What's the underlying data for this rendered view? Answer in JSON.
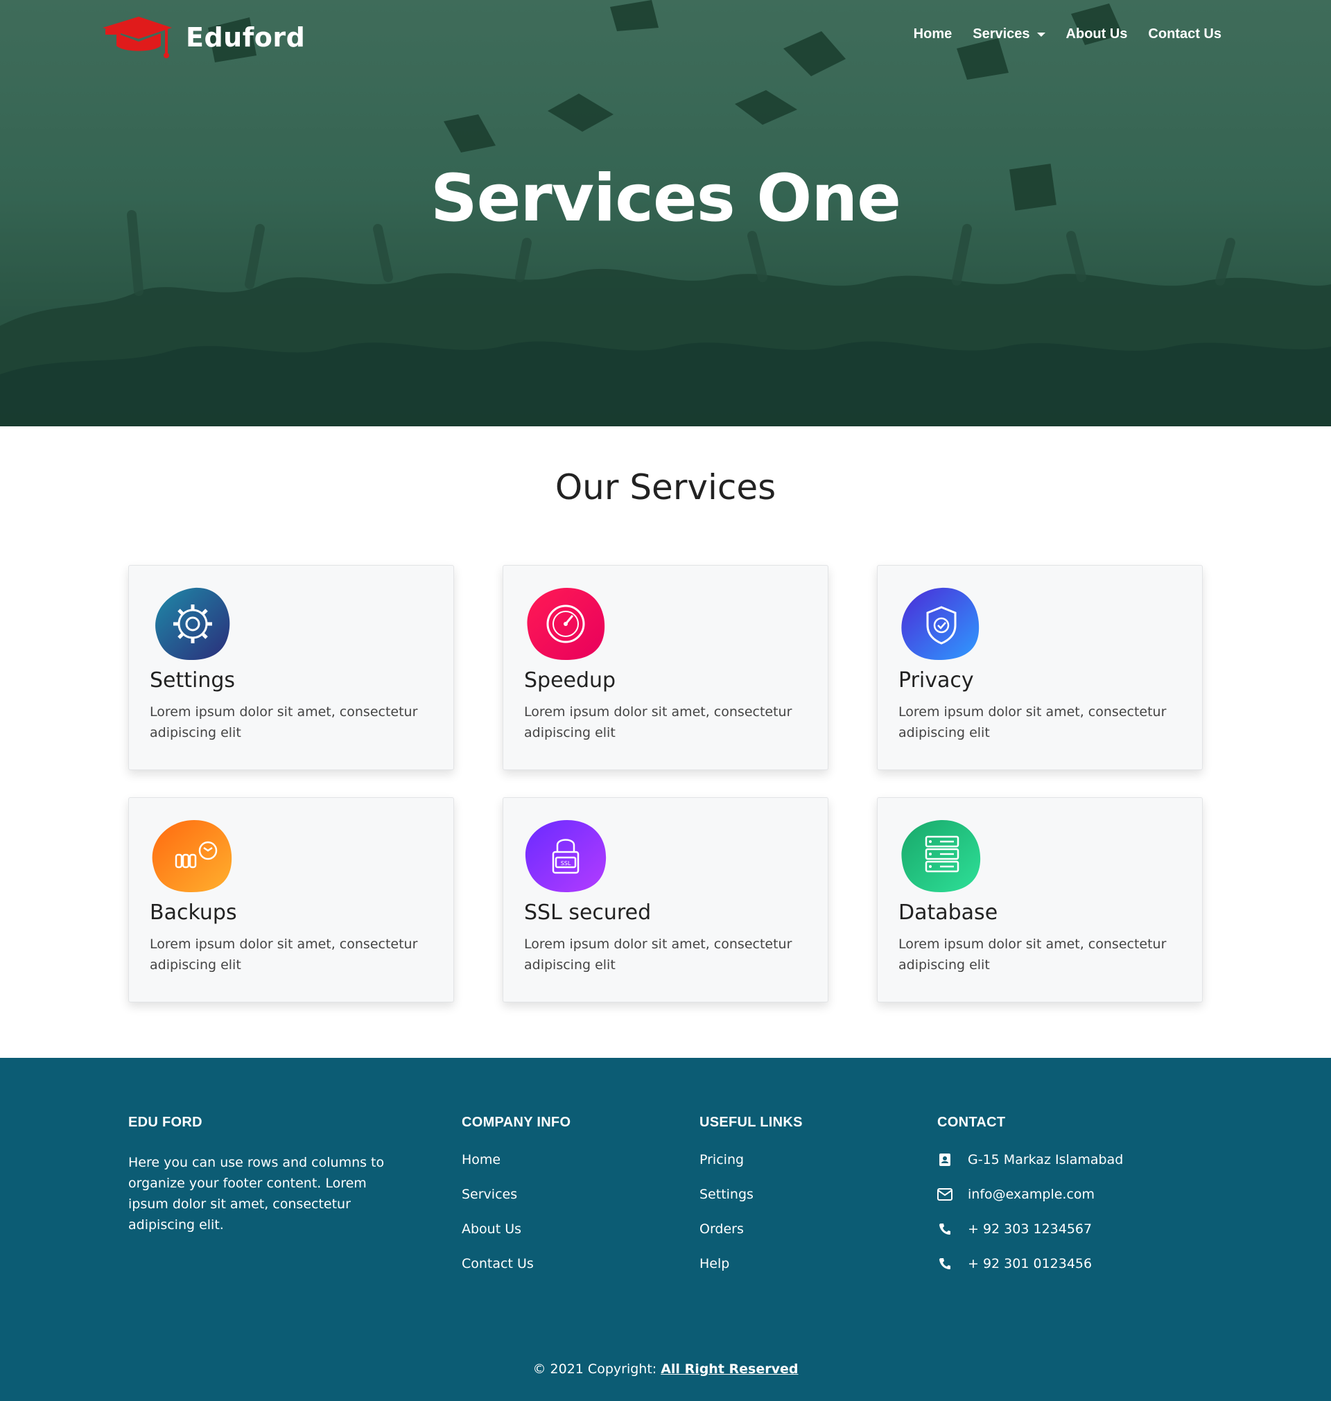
{
  "brand": {
    "name": "Eduford"
  },
  "nav": {
    "home": "Home",
    "services": "Services",
    "about": "About Us",
    "contact": "Contact Us"
  },
  "hero": {
    "title": "Services One"
  },
  "services": {
    "title": "Our Services",
    "items": [
      {
        "title": "Settings",
        "text": "Lorem ipsum dolor sit amet, consectetur adipiscing elit",
        "icon": "gear-icon",
        "colors": [
          "#1f8aa8",
          "#2b2d7a"
        ]
      },
      {
        "title": "Speedup",
        "text": "Lorem ipsum dolor sit amet, consectetur adipiscing elit",
        "icon": "speedometer-icon",
        "colors": [
          "#ff1a55",
          "#e8005c"
        ]
      },
      {
        "title": "Privacy",
        "text": "Lorem ipsum dolor sit amet, consectetur adipiscing elit",
        "icon": "shield-check-icon",
        "colors": [
          "#2f5bff",
          "#4b2bd6"
        ]
      },
      {
        "title": "Backups",
        "text": "Lorem ipsum dolor sit amet, consectetur adipiscing elit",
        "icon": "backup-icon",
        "colors": [
          "#ff7a1a",
          "#ffb02e"
        ]
      },
      {
        "title": "SSL secured",
        "text": "Lorem ipsum dolor sit amet, consectetur adipiscing elit",
        "icon": "ssl-lock-icon",
        "colors": [
          "#9b3cff",
          "#6a2bff"
        ]
      },
      {
        "title": "Database",
        "text": "Lorem ipsum dolor sit amet, consectetur adipiscing elit",
        "icon": "database-icon",
        "colors": [
          "#1fc07a",
          "#22d48a"
        ]
      }
    ]
  },
  "footer": {
    "about": {
      "heading": "EDU FORD",
      "text": "Here you can use rows and columns to organize your footer content. Lorem ipsum dolor sit amet, consectetur adipiscing elit."
    },
    "company": {
      "heading": "COMPANY INFO",
      "links": [
        "Home",
        "Services",
        "About Us",
        "Contact Us"
      ]
    },
    "useful": {
      "heading": "USEFUL LINKS",
      "links": [
        "Pricing",
        "Settings",
        "Orders",
        "Help"
      ]
    },
    "contact": {
      "heading": "CONTACT",
      "address": "G-15 Markaz Islamabad",
      "email": "info@example.com",
      "phone1": "+ 92 303 1234567",
      "phone2": "+ 92 301 0123456"
    },
    "copyright": {
      "prefix": "© 2021 Copyright: ",
      "link": "All Right Reserved"
    }
  },
  "colors": {
    "hero_overlay": "#3f6d5b",
    "footer_bg": "#0c5c74",
    "logo_red": "#e01b1b"
  }
}
